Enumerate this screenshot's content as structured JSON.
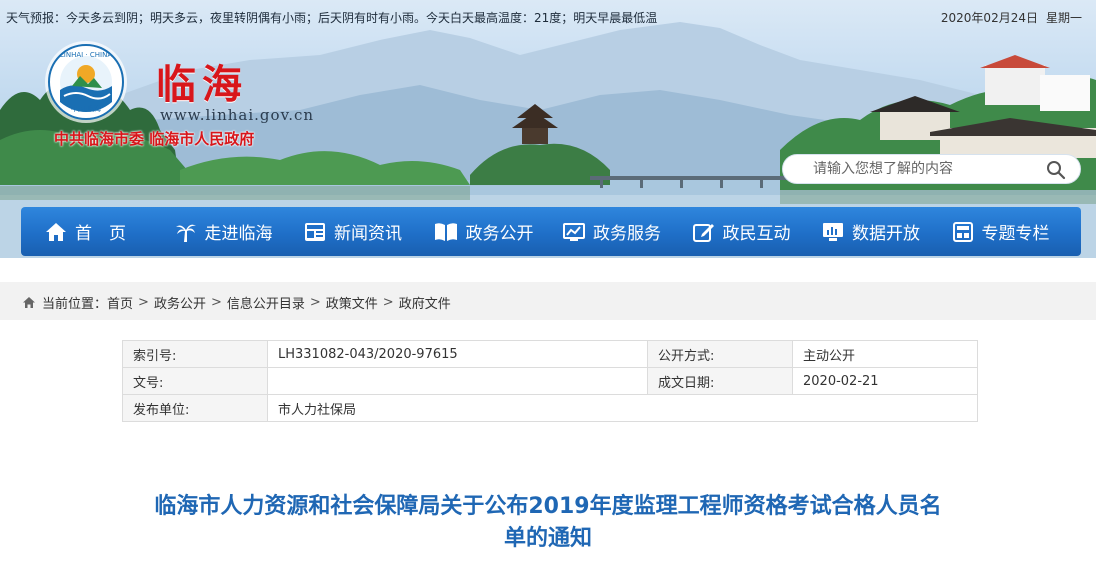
{
  "header": {
    "weather": "天气预报：今天多云到阴；明天多云，夜里转阴偶有小雨；后天阴有时有小雨。今天白天最高温度：21度；明天早晨最低温",
    "date": "2020年02月24日",
    "weekday": "星期一",
    "logo_ring_text": "LINHAI · CHINA",
    "logo_bottom_text": "中国·临海",
    "site_name": "临海",
    "site_url": "www.linhai.gov.cn",
    "org_line": "中共临海市委  临海市人民政府",
    "search_placeholder": "请输入您想了解的内容",
    "brand_color": "#d8161b",
    "nav_color": "#1f6fc8"
  },
  "nav": {
    "items": [
      {
        "label": "首　页",
        "icon": "home-icon"
      },
      {
        "label": "走进临海",
        "icon": "palm-tree-icon"
      },
      {
        "label": "新闻资讯",
        "icon": "newspaper-icon"
      },
      {
        "label": "政务公开",
        "icon": "open-book-icon"
      },
      {
        "label": "政务服务",
        "icon": "service-chart-icon"
      },
      {
        "label": "政民互动",
        "icon": "edit-icon"
      },
      {
        "label": "数据开放",
        "icon": "monitor-icon"
      },
      {
        "label": "专题专栏",
        "icon": "column-icon"
      }
    ]
  },
  "breadcrumb": {
    "prefix": "当前位置：",
    "items": [
      "首页",
      "政务公开",
      "信息公开目录",
      "政策文件",
      "政府文件"
    ],
    "separator": ">"
  },
  "meta": {
    "index_label": "索引号:",
    "index_value": "LH331082-043/2020-97615",
    "method_label": "公开方式:",
    "method_value": "主动公开",
    "docno_label": "文号:",
    "docno_value": "",
    "date_label": "成文日期:",
    "date_value": "2020-02-21",
    "publisher_label": "发布单位:",
    "publisher_value": "市人力社保局"
  },
  "article": {
    "title_line1": "临海市人力资源和社会保障局关于公布2019年度监理工程师资格考试合格人员名",
    "title_line2": "单的通知",
    "title_color": "#1f67b4"
  }
}
